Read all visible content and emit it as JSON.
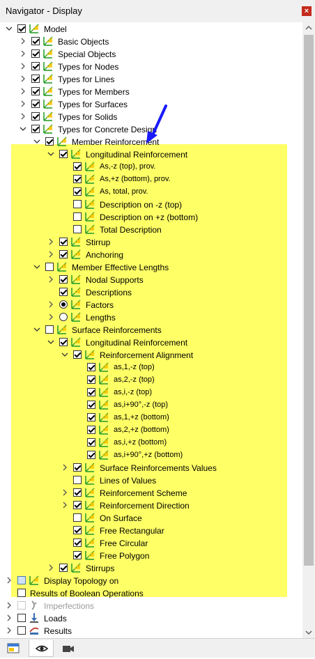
{
  "window": {
    "title": "Navigator - Display",
    "close_glyph": "×"
  },
  "colors": {
    "highlight": "#ffff66",
    "arrow": "#1a1aff",
    "icon_green": "#2ca02c",
    "icon_yellow": "#f5c400"
  },
  "tree": [
    {
      "id": "model",
      "label": "Model",
      "level": 0,
      "expander": "open",
      "control": "checkbox",
      "state": "checked",
      "icon": "model-icon"
    },
    {
      "id": "basic-objects",
      "label": "Basic Objects",
      "level": 1,
      "expander": "closed",
      "control": "checkbox",
      "state": "checked",
      "icon": "model-icon"
    },
    {
      "id": "special-objects",
      "label": "Special Objects",
      "level": 1,
      "expander": "closed",
      "control": "checkbox",
      "state": "checked",
      "icon": "model-icon"
    },
    {
      "id": "types-for-nodes",
      "label": "Types for Nodes",
      "level": 1,
      "expander": "closed",
      "control": "checkbox",
      "state": "checked",
      "icon": "model-icon"
    },
    {
      "id": "types-for-lines",
      "label": "Types for Lines",
      "level": 1,
      "expander": "closed",
      "control": "checkbox",
      "state": "checked",
      "icon": "model-icon"
    },
    {
      "id": "types-for-members",
      "label": "Types for Members",
      "level": 1,
      "expander": "closed",
      "control": "checkbox",
      "state": "checked",
      "icon": "model-icon"
    },
    {
      "id": "types-for-surfaces",
      "label": "Types for Surfaces",
      "level": 1,
      "expander": "closed",
      "control": "checkbox",
      "state": "checked",
      "icon": "model-icon"
    },
    {
      "id": "types-for-solids",
      "label": "Types for Solids",
      "level": 1,
      "expander": "closed",
      "control": "checkbox",
      "state": "checked",
      "icon": "model-icon"
    },
    {
      "id": "types-for-concrete-design",
      "label": "Types for Concrete Design",
      "level": 1,
      "expander": "open",
      "control": "checkbox",
      "state": "checked",
      "icon": "model-icon"
    },
    {
      "id": "member-reinforcement",
      "label": "Member Reinforcement",
      "level": 2,
      "expander": "open",
      "control": "checkbox",
      "state": "checked",
      "icon": "model-icon"
    },
    {
      "id": "longitudinal-reinforcement",
      "label": "Longitudinal Reinforcement",
      "level": 3,
      "expander": "open",
      "control": "checkbox",
      "state": "checked",
      "icon": "model-icon"
    },
    {
      "id": "as-z-top",
      "label": "As,-z (top), prov.",
      "level": 4,
      "expander": "none",
      "control": "checkbox",
      "state": "checked",
      "icon": "model-icon",
      "small": true
    },
    {
      "id": "as-z-bottom",
      "label": "As,+z (bottom), prov.",
      "level": 4,
      "expander": "none",
      "control": "checkbox",
      "state": "checked",
      "icon": "model-icon",
      "small": true
    },
    {
      "id": "as-total",
      "label": "As, total, prov.",
      "level": 4,
      "expander": "none",
      "control": "checkbox",
      "state": "checked",
      "icon": "model-icon",
      "small": true
    },
    {
      "id": "description-top",
      "label": "Description on -z (top)",
      "level": 4,
      "expander": "none",
      "control": "checkbox",
      "state": "unchecked",
      "icon": "model-icon"
    },
    {
      "id": "description-bottom",
      "label": "Description on +z (bottom)",
      "level": 4,
      "expander": "none",
      "control": "checkbox",
      "state": "unchecked",
      "icon": "model-icon"
    },
    {
      "id": "total-description",
      "label": "Total Description",
      "level": 4,
      "expander": "none",
      "control": "checkbox",
      "state": "unchecked",
      "icon": "model-icon"
    },
    {
      "id": "stirrup",
      "label": "Stirrup",
      "level": 3,
      "expander": "closed",
      "control": "checkbox",
      "state": "checked",
      "icon": "model-icon"
    },
    {
      "id": "anchoring",
      "label": "Anchoring",
      "level": 3,
      "expander": "closed",
      "control": "checkbox",
      "state": "checked",
      "icon": "model-icon"
    },
    {
      "id": "member-effective-lengths",
      "label": "Member Effective Lengths",
      "level": 2,
      "expander": "open",
      "control": "checkbox",
      "state": "unchecked",
      "icon": "model-icon"
    },
    {
      "id": "nodal-supports",
      "label": "Nodal Supports",
      "level": 3,
      "expander": "closed",
      "control": "checkbox",
      "state": "checked",
      "icon": "model-icon"
    },
    {
      "id": "descriptions",
      "label": "Descriptions",
      "level": 3,
      "expander": "none",
      "control": "checkbox",
      "state": "checked",
      "icon": "model-icon"
    },
    {
      "id": "factors",
      "label": "Factors",
      "level": 3,
      "expander": "closed",
      "control": "radio",
      "state": "on",
      "icon": "model-icon"
    },
    {
      "id": "lengths",
      "label": "Lengths",
      "level": 3,
      "expander": "closed",
      "control": "radio",
      "state": "off",
      "icon": "model-icon"
    },
    {
      "id": "surface-reinforcements",
      "label": "Surface Reinforcements",
      "level": 2,
      "expander": "open",
      "control": "checkbox",
      "state": "unchecked",
      "icon": "model-icon"
    },
    {
      "id": "surface-longitudinal-reinforcement",
      "label": "Longitudinal Reinforcement",
      "level": 3,
      "expander": "open",
      "control": "checkbox",
      "state": "checked",
      "icon": "model-icon"
    },
    {
      "id": "reinforcement-alignment",
      "label": "Reinforcement Alignment",
      "level": 4,
      "expander": "open",
      "control": "checkbox",
      "state": "checked",
      "icon": "model-icon"
    },
    {
      "id": "as1-top",
      "label": "as,1,-z (top)",
      "level": 5,
      "expander": "none",
      "control": "checkbox",
      "state": "checked",
      "icon": "model-icon",
      "small": true
    },
    {
      "id": "as2-top",
      "label": "as,2,-z (top)",
      "level": 5,
      "expander": "none",
      "control": "checkbox",
      "state": "checked",
      "icon": "model-icon",
      "small": true
    },
    {
      "id": "asi-top",
      "label": "as,i,-z (top)",
      "level": 5,
      "expander": "none",
      "control": "checkbox",
      "state": "checked",
      "icon": "model-icon",
      "small": true
    },
    {
      "id": "asi90-top",
      "label": "as,i+90°,-z (top)",
      "level": 5,
      "expander": "none",
      "control": "checkbox",
      "state": "checked",
      "icon": "model-icon",
      "small": true
    },
    {
      "id": "as1-bottom",
      "label": "as,1,+z (bottom)",
      "level": 5,
      "expander": "none",
      "control": "checkbox",
      "state": "checked",
      "icon": "model-icon",
      "small": true
    },
    {
      "id": "as2-bottom",
      "label": "as,2,+z (bottom)",
      "level": 5,
      "expander": "none",
      "control": "checkbox",
      "state": "checked",
      "icon": "model-icon",
      "small": true
    },
    {
      "id": "asi-bottom",
      "label": "as,i,+z (bottom)",
      "level": 5,
      "expander": "none",
      "control": "checkbox",
      "state": "checked",
      "icon": "model-icon",
      "small": true
    },
    {
      "id": "asi90-bottom",
      "label": "as,i+90°,+z (bottom)",
      "level": 5,
      "expander": "none",
      "control": "checkbox",
      "state": "checked",
      "icon": "model-icon",
      "small": true
    },
    {
      "id": "surface-reinforcements-values",
      "label": "Surface Reinforcements Values",
      "level": 4,
      "expander": "closed",
      "control": "checkbox",
      "state": "checked",
      "icon": "model-icon"
    },
    {
      "id": "lines-of-values",
      "label": "Lines of Values",
      "level": 4,
      "expander": "none",
      "control": "checkbox",
      "state": "unchecked",
      "icon": "model-icon"
    },
    {
      "id": "reinforcement-scheme",
      "label": "Reinforcement Scheme",
      "level": 4,
      "expander": "closed",
      "control": "checkbox",
      "state": "checked",
      "icon": "model-icon"
    },
    {
      "id": "reinforcement-direction",
      "label": "Reinforcement Direction",
      "level": 4,
      "expander": "closed",
      "control": "checkbox",
      "state": "checked",
      "icon": "model-icon"
    },
    {
      "id": "on-surface",
      "label": "On Surface",
      "level": 4,
      "expander": "none",
      "control": "checkbox",
      "state": "unchecked",
      "icon": "model-icon"
    },
    {
      "id": "free-rectangular",
      "label": "Free Rectangular",
      "level": 4,
      "expander": "none",
      "control": "checkbox",
      "state": "checked",
      "icon": "model-icon"
    },
    {
      "id": "free-circular",
      "label": "Free Circular",
      "level": 4,
      "expander": "none",
      "control": "checkbox",
      "state": "checked",
      "icon": "model-icon"
    },
    {
      "id": "free-polygon",
      "label": "Free Polygon",
      "level": 4,
      "expander": "none",
      "control": "checkbox",
      "state": "checked",
      "icon": "model-icon"
    },
    {
      "id": "stirrups",
      "label": "Stirrups",
      "level": 3,
      "expander": "closed",
      "control": "checkbox",
      "state": "checked",
      "icon": "model-icon"
    },
    {
      "id": "display-topology-on",
      "label": "Display Topology on",
      "level": 0,
      "expander": "closed",
      "control": "checkbox",
      "state": "partial",
      "icon": "model-icon"
    },
    {
      "id": "results-boolean",
      "label": "Results of Boolean Operations",
      "level": 0,
      "expander": "none",
      "control": "checkbox",
      "state": "unchecked",
      "icon": "none"
    },
    {
      "id": "imperfections",
      "label": "Imperfections",
      "level": 0,
      "expander": "closed",
      "control": "checkbox",
      "state": "disabled",
      "icon": "imperfection-icon",
      "gray": true
    },
    {
      "id": "loads",
      "label": "Loads",
      "level": 0,
      "expander": "closed",
      "control": "checkbox",
      "state": "unchecked",
      "icon": "loads-icon"
    },
    {
      "id": "results",
      "label": "Results",
      "level": 0,
      "expander": "closed",
      "control": "checkbox",
      "state": "unchecked",
      "icon": "results-icon"
    }
  ],
  "bottom_tabs": [
    {
      "id": "data",
      "icon": "data-navigator-icon",
      "active": false
    },
    {
      "id": "display",
      "icon": "eye-icon",
      "active": true
    },
    {
      "id": "views",
      "icon": "camera-icon",
      "active": false
    }
  ]
}
